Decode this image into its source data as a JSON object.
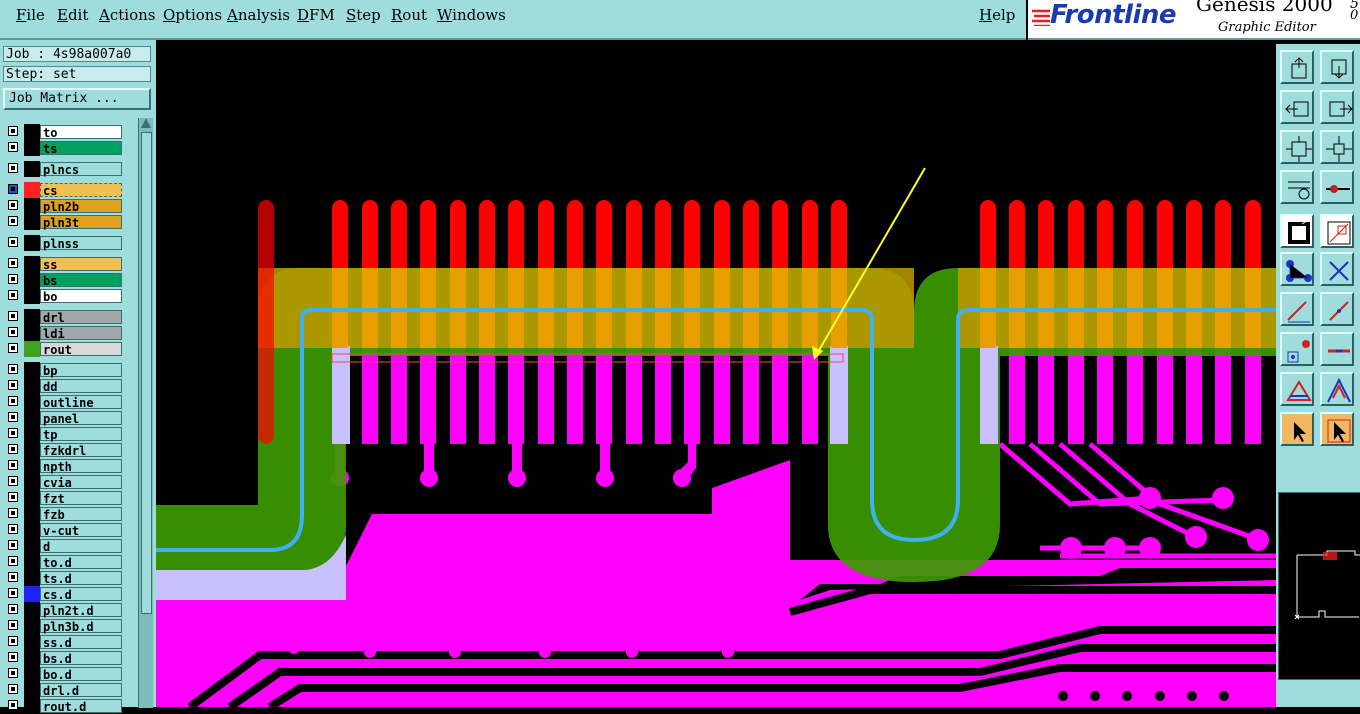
{
  "menu": [
    "File",
    "Edit",
    "Actions",
    "Options",
    "Analysis",
    "DFM",
    "Step",
    "Rout",
    "Windows"
  ],
  "help": "Help",
  "brand": {
    "logo": "Frontline",
    "product": "Genesis 2000",
    "version": "5.",
    "version_sub": "0",
    "subtitle": "Graphic Editor"
  },
  "job": {
    "job_label": "Job : 4s98a007a0",
    "step_label": "Step: set",
    "matrix_button": "Job Matrix ..."
  },
  "layers": [
    {
      "name": "to",
      "color": "#ffffff"
    },
    {
      "name": "ts",
      "color": "#00a060"
    },
    {
      "name": "plncs",
      "color": "#9fdcdc"
    },
    {
      "name": "cs",
      "color": "#f0c050",
      "swatch": "#ff2020",
      "active": true
    },
    {
      "name": "pln2b",
      "color": "#e0a020"
    },
    {
      "name": "pln3t",
      "color": "#e0a020"
    },
    {
      "name": "plnss",
      "color": "#9fdcdc"
    },
    {
      "name": "ss",
      "color": "#f0c050"
    },
    {
      "name": "bs",
      "color": "#00a060"
    },
    {
      "name": "bo",
      "color": "#ffffff"
    },
    {
      "name": "drl",
      "color": "#a0a8a8"
    },
    {
      "name": "ldi",
      "color": "#a0a8a8"
    },
    {
      "name": "rout",
      "color": "#d8d8d8",
      "swatch": "#40a020"
    },
    {
      "name": "bp",
      "color": "#9fdcdc"
    },
    {
      "name": "dd",
      "color": "#9fdcdc"
    },
    {
      "name": "outline",
      "color": "#9fdcdc"
    },
    {
      "name": "panel",
      "color": "#9fdcdc"
    },
    {
      "name": "tp",
      "color": "#9fdcdc"
    },
    {
      "name": "fzkdrl",
      "color": "#9fdcdc"
    },
    {
      "name": "npth",
      "color": "#9fdcdc"
    },
    {
      "name": "cvia",
      "color": "#9fdcdc"
    },
    {
      "name": "fzt",
      "color": "#9fdcdc"
    },
    {
      "name": "fzb",
      "color": "#9fdcdc"
    },
    {
      "name": "v-cut",
      "color": "#9fdcdc"
    },
    {
      "name": "d",
      "color": "#9fdcdc"
    },
    {
      "name": "to.d",
      "color": "#9fdcdc"
    },
    {
      "name": "ts.d",
      "color": "#9fdcdc"
    },
    {
      "name": "cs.d",
      "color": "#9fdcdc",
      "swatch": "#2020ff"
    },
    {
      "name": "pln2t.d",
      "color": "#9fdcdc"
    },
    {
      "name": "pln3b.d",
      "color": "#9fdcdc"
    },
    {
      "name": "ss.d",
      "color": "#9fdcdc"
    },
    {
      "name": "bs.d",
      "color": "#9fdcdc"
    },
    {
      "name": "bo.d",
      "color": "#9fdcdc"
    },
    {
      "name": "drl.d",
      "color": "#9fdcdc"
    },
    {
      "name": "rout.d",
      "color": "#9fdcdc"
    }
  ],
  "colors": {
    "pad_red": "#ff0000",
    "copper_magenta": "#ff00ff",
    "mask_green": "#3c9a00",
    "trace_blue": "#40b0f0",
    "arrow_yellow": "#ffff30",
    "overlap_gold": "#c09a00"
  },
  "tools": [
    "zoom-home-icon",
    "zoom-in-icon",
    "pan-left-icon",
    "pan-right-icon",
    "fit-icon",
    "center-icon",
    "measure-icon",
    "snap-icon",
    "select-box-icon",
    "feature-icon",
    "net-icon",
    "cross-icon",
    "line-icon",
    "line2-icon",
    "pad-icon",
    "segment-icon",
    "triangle-icon",
    "triangle2-icon",
    "pointer-icon",
    "pointer-box-icon"
  ]
}
